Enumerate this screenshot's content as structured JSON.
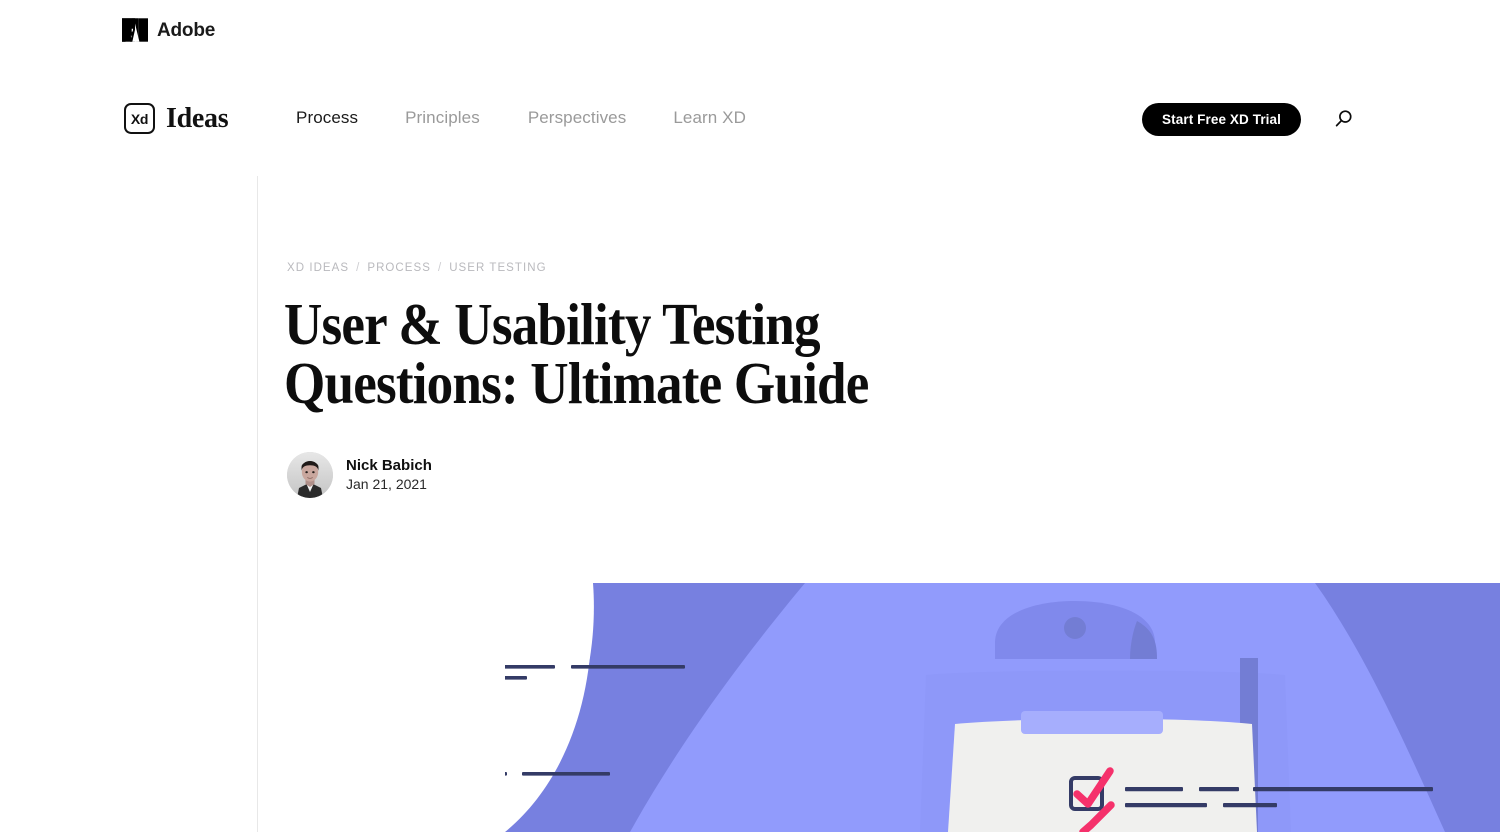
{
  "brand_bar": {
    "logo_icon": "adobe-a-mark",
    "name": "Adobe"
  },
  "nav": {
    "logo": {
      "badge": "Xd",
      "word": "Ideas",
      "icon": "xd-logo-icon"
    },
    "links": [
      {
        "label": "Process",
        "active": true
      },
      {
        "label": "Principles",
        "active": false
      },
      {
        "label": "Perspectives",
        "active": false
      },
      {
        "label": "Learn XD",
        "active": false
      }
    ],
    "cta_label": "Start Free XD Trial",
    "search_icon": "search-icon"
  },
  "article": {
    "breadcrumb": [
      "XD IDEAS",
      "PROCESS",
      "USER TESTING"
    ],
    "breadcrumb_separator": "/",
    "title": "User & Usability Testing Questions: Ultimate Guide",
    "author": {
      "name": "Nick Babich",
      "date": "Jan 21, 2021",
      "avatar_icon": "author-avatar-photo"
    }
  },
  "hero_illustration": {
    "name": "usability-testing-clipboard-illustration",
    "colors": {
      "background_light_purple": "#919BFC",
      "shape_dark_purple": "#7780E0",
      "clipboard_board": "#8E98F9",
      "clip": "#8089EC",
      "clip_shadow": "#737DD4",
      "paper": "#F0F0EE",
      "paper_header_band": "#A6AEFD",
      "line_navy": "#343B66",
      "check_pink": "#F5316B",
      "page_white": "#FFFFFF"
    }
  },
  "colors": {
    "accent_black": "#000000",
    "text_primary": "#101010",
    "text_muted": "#9a9a9a",
    "breadcrumb": "#b9b9bd",
    "rule": "#e8e8e8"
  }
}
